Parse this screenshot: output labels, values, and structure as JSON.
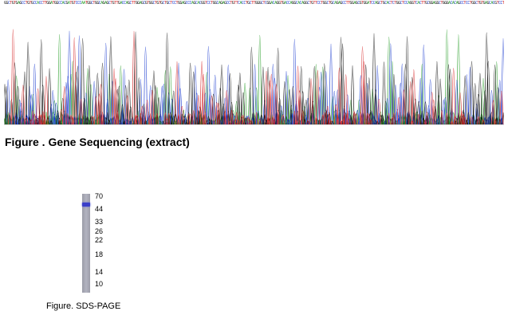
{
  "sequencing_figure": {
    "caption": "Figure . Gene Sequencing (extract)",
    "base_strip": "GGCTGTGAGCCTGTGCCACCTTGGATGGCCACGATGTCCCAATGGCTGGCAGAGCTGTTGACCAGCTTGGAGCGTGGCTGTGCTGCTCCTGGAGCCCAGCACGGTCCTGGCAGAGCCTGTTCACCTGCTTGGGCTCGGACAGGTGACCAGGCACAGGCTGTTCCTGGCTGCAGAGCCTTGGAGCGTGGATCCAGCTGCACTCTGGCTCCAGGTCACTTGCGGAGGCTGGGACACAGCCTCCTGGCTGTGAGCACGTCCTTGGAGCCCAGGCTTCATTGGCACGAGCGGAAGGGCCTGAGCTC",
    "base_colors": {
      "A": "#2ca02c",
      "C": "#1f3fd0",
      "G": "#111111",
      "T": "#d62728"
    }
  },
  "gel_figure": {
    "caption": "Figure. SDS-PAGE",
    "markers": [
      "70",
      "44",
      "33",
      "26",
      "22",
      "18",
      "14",
      "10"
    ],
    "lane_color": "#a8a9b6",
    "band_color": "#3a3fc8"
  }
}
